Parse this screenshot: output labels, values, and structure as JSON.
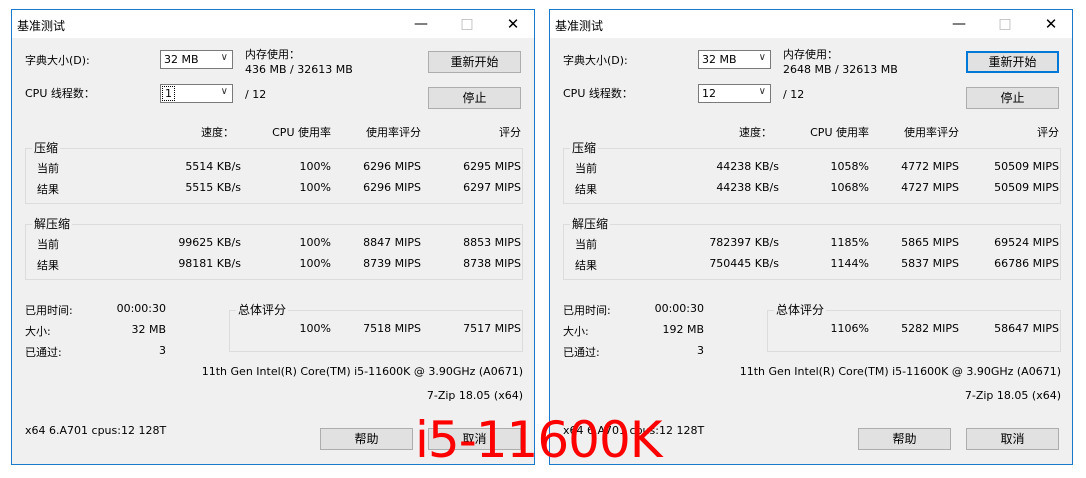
{
  "windows": [
    {
      "title": "基准测试",
      "dict_label": "字典大小(D):",
      "dict_value": "32 MB",
      "mem_label": "内存使用：",
      "mem_value": "436 MB / 32613 MB",
      "threads_label": "CPU 线程数：",
      "threads_value": "1",
      "threads_total": "/ 12",
      "restart_label": "重新开始",
      "stop_label": "停止",
      "col_speed": "速度：",
      "col_cpu": "CPU 使用率",
      "col_rating_usage": "使用率评分",
      "col_rating": "评分",
      "compress": {
        "label": "压缩",
        "rows": [
          {
            "name": "当前",
            "speed": "5514 KB/s",
            "cpu": "100%",
            "usage": "6296 MIPS",
            "rating": "6295 MIPS"
          },
          {
            "name": "结果",
            "speed": "5515 KB/s",
            "cpu": "100%",
            "usage": "6296 MIPS",
            "rating": "6297 MIPS"
          }
        ]
      },
      "decompress": {
        "label": "解压缩",
        "rows": [
          {
            "name": "当前",
            "speed": "99625 KB/s",
            "cpu": "100%",
            "usage": "8847 MIPS",
            "rating": "8853 MIPS"
          },
          {
            "name": "结果",
            "speed": "98181 KB/s",
            "cpu": "100%",
            "usage": "8739 MIPS",
            "rating": "8738 MIPS"
          }
        ]
      },
      "elapsed_label": "已用时间:",
      "elapsed_value": "00:00:30",
      "size_label": "大小:",
      "size_value": "32 MB",
      "passes_label": "已通过:",
      "passes_value": "3",
      "total_label": "总体评分",
      "total_cpu": "100%",
      "total_usage": "7518 MIPS",
      "total_rating": "7517 MIPS",
      "cpu_name": "11th Gen Intel(R) Core(TM) i5-11600K @ 3.90GHz (A0671)",
      "version": "7-Zip 18.05 (x64)",
      "sysinfo": "x64 6.A701 cpus:12 128T",
      "help_label": "帮助",
      "cancel_label": "取消"
    },
    {
      "title": "基准测试",
      "dict_label": "字典大小(D):",
      "dict_value": "32 MB",
      "mem_label": "内存使用：",
      "mem_value": "2648 MB / 32613 MB",
      "threads_label": "CPU 线程数：",
      "threads_value": "12",
      "threads_total": "/ 12",
      "restart_label": "重新开始",
      "stop_label": "停止",
      "col_speed": "速度：",
      "col_cpu": "CPU 使用率",
      "col_rating_usage": "使用率评分",
      "col_rating": "评分",
      "compress": {
        "label": "压缩",
        "rows": [
          {
            "name": "当前",
            "speed": "44238 KB/s",
            "cpu": "1058%",
            "usage": "4772 MIPS",
            "rating": "50509 MIPS"
          },
          {
            "name": "结果",
            "speed": "44238 KB/s",
            "cpu": "1068%",
            "usage": "4727 MIPS",
            "rating": "50509 MIPS"
          }
        ]
      },
      "decompress": {
        "label": "解压缩",
        "rows": [
          {
            "name": "当前",
            "speed": "782397 KB/s",
            "cpu": "1185%",
            "usage": "5865 MIPS",
            "rating": "69524 MIPS"
          },
          {
            "name": "结果",
            "speed": "750445 KB/s",
            "cpu": "1144%",
            "usage": "5837 MIPS",
            "rating": "66786 MIPS"
          }
        ]
      },
      "elapsed_label": "已用时间:",
      "elapsed_value": "00:00:30",
      "size_label": "大小:",
      "size_value": "192 MB",
      "passes_label": "已通过:",
      "passes_value": "3",
      "total_label": "总体评分",
      "total_cpu": "1106%",
      "total_usage": "5282 MIPS",
      "total_rating": "58647 MIPS",
      "cpu_name": "11th Gen Intel(R) Core(TM) i5-11600K @ 3.90GHz (A0671)",
      "version": "7-Zip 18.05 (x64)",
      "sysinfo": "x64 6.A701 cpus:12 128T",
      "help_label": "帮助",
      "cancel_label": "取消"
    }
  ],
  "overlay_text": "i5-11600K",
  "colors": {
    "overlay": "#ff0000",
    "border": "#1979ca",
    "dialog_bg": "#f0f0f0"
  },
  "icons": {
    "minimize": "minimize-icon",
    "maximize": "maximize-icon",
    "close": "close-icon",
    "dropdown": "chevron-down-icon"
  }
}
